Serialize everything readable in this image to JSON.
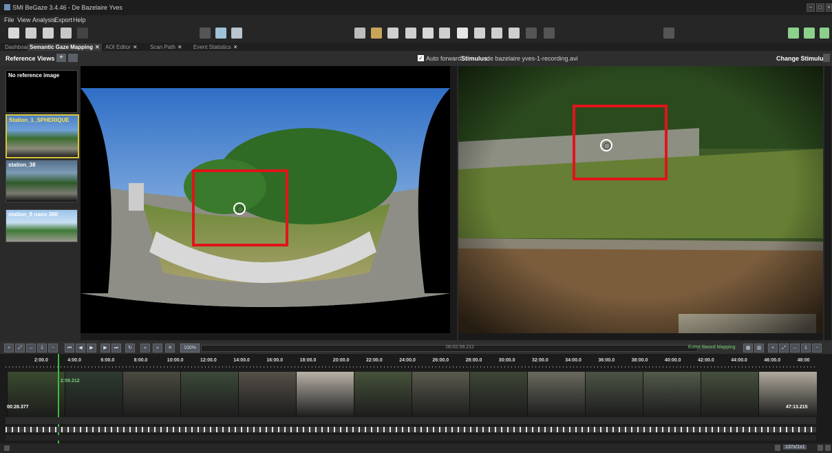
{
  "window": {
    "title": "SMI BeGaze 3.4.46 - De Bazelaire Yves"
  },
  "menu": [
    "File",
    "View",
    "Analysis",
    "Export",
    "Help"
  ],
  "tabs": [
    {
      "label": "Dashboard",
      "active": false
    },
    {
      "label": "Semantic Gaze Mapping",
      "active": true
    },
    {
      "label": "AOI Editor",
      "active": false
    },
    {
      "label": "Scan Path",
      "active": false
    },
    {
      "label": "Event Statistics",
      "active": false
    }
  ],
  "header": {
    "reference_views_label": "Reference Views",
    "auto_forward_label": "Auto forward",
    "auto_forward_checked": true,
    "stimulus_label": "Stimulus:",
    "stimulus_value": "de bazelaire yves-1-recording.avi",
    "change_stimulus_label": "Change Stimulus:"
  },
  "reference_images": [
    {
      "label": "No reference image"
    },
    {
      "label": "Station_1_SPHERIQUE",
      "selected": true
    },
    {
      "label": "station_38"
    },
    {
      "label": "station_9 nano 360"
    }
  ],
  "controls": {
    "playback_time": "00:02:59.212",
    "mapping_mode": "Event Based Mapping",
    "speed": "100%"
  },
  "timeline": {
    "ticks": [
      "2:00.0",
      "4:00.0",
      "6:00.0",
      "8:00.0",
      "10:00.0",
      "12:00.0",
      "14:00.0",
      "16:00.0",
      "18:00.0",
      "20:00.0",
      "22:00.0",
      "24:00.0",
      "26:00.0",
      "28:00.0",
      "30:00.0",
      "32:00.0",
      "34:00.0",
      "36:00.0",
      "38:00.0",
      "40:00.0",
      "42:00.0",
      "44:00.0",
      "46:00.0",
      "48:00"
    ],
    "cursor_time": "2:59.212",
    "start_time": "00:28.377",
    "end_time": "47:13.215"
  },
  "footer": {
    "zoom": "137x/1x1"
  },
  "colors": {
    "highlight": "#e0141a",
    "accent_green": "#7bd17b"
  }
}
